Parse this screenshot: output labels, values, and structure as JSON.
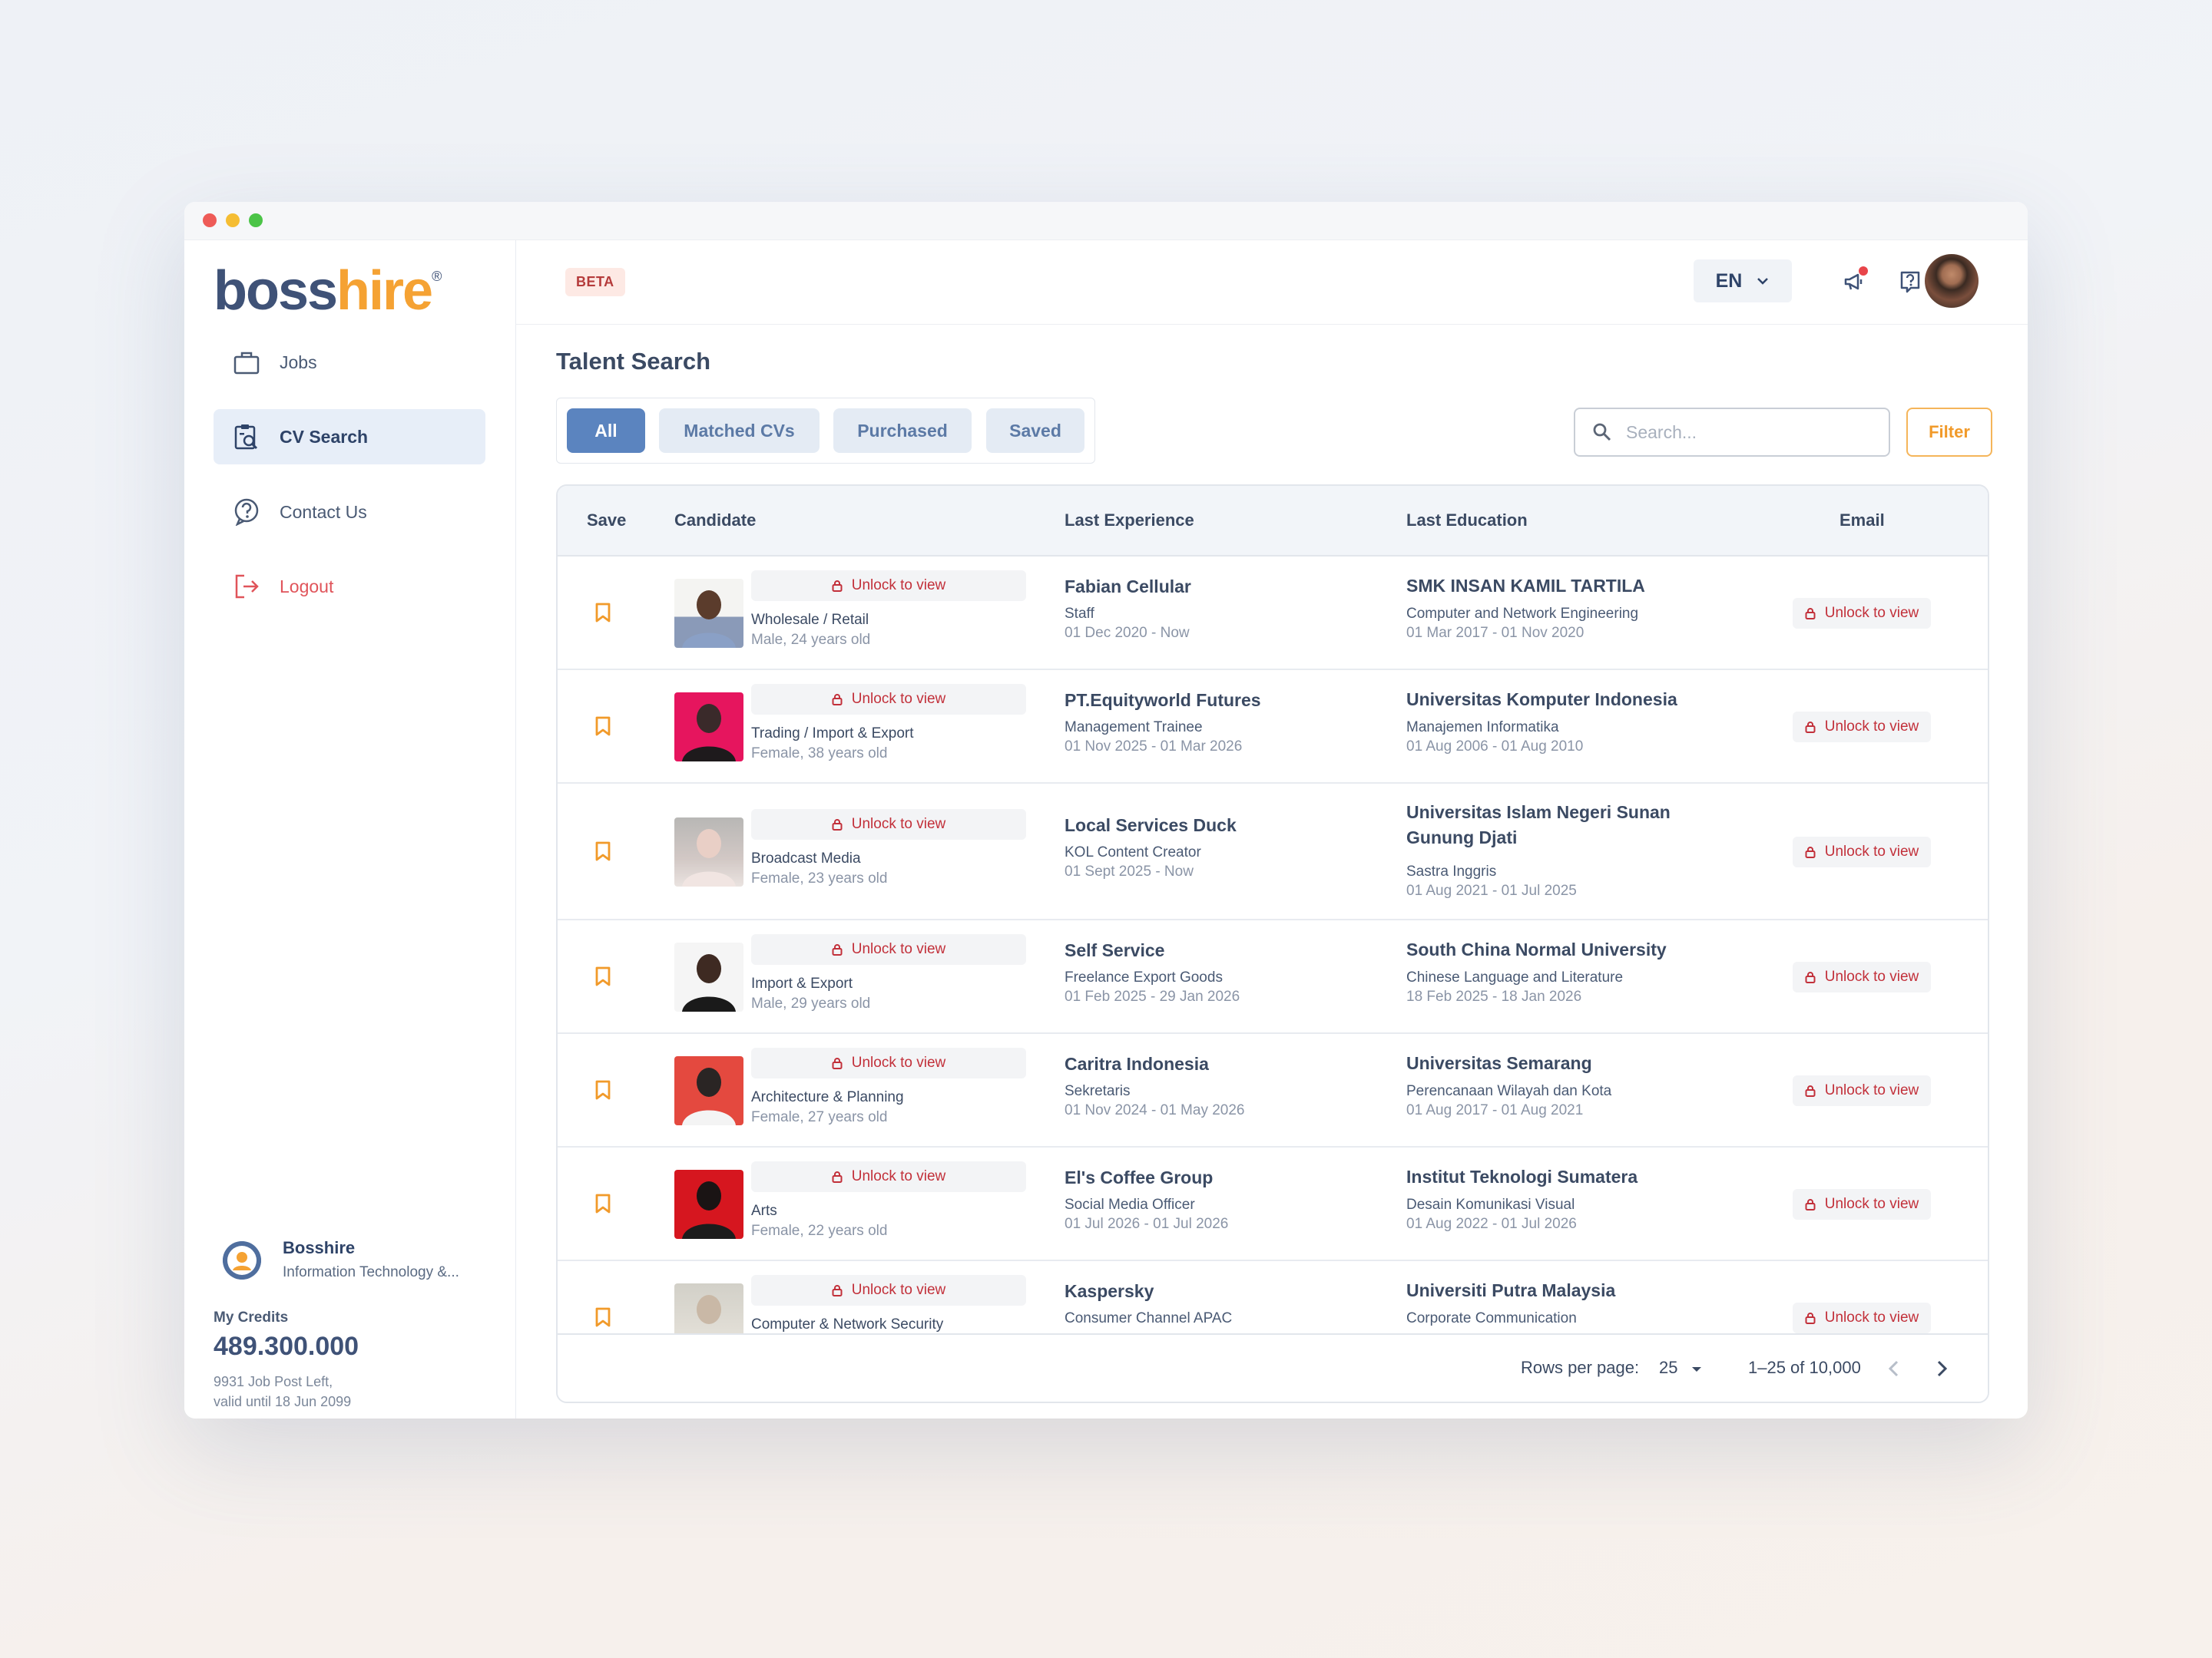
{
  "brand": {
    "part1": "boss",
    "part2": "hire",
    "reg": "®"
  },
  "sidebar": {
    "items": [
      {
        "label": "Jobs",
        "icon": "briefcase-icon"
      },
      {
        "label": "CV Search",
        "icon": "cv-search-icon",
        "active": true
      },
      {
        "label": "Contact Us",
        "icon": "help-circle-icon"
      },
      {
        "label": "Logout",
        "icon": "logout-icon"
      }
    ]
  },
  "profile": {
    "name": "Bosshire",
    "company": "Information Technology &..."
  },
  "credits": {
    "label": "My Credits",
    "value": "489.300.000",
    "note1": "9931 Job Post Left,",
    "note2": "valid until 18 Jun 2099"
  },
  "topbar": {
    "badge": "BETA",
    "language": "EN"
  },
  "page": {
    "title": "Talent Search"
  },
  "tabs": [
    "All",
    "Matched CVs",
    "Purchased",
    "Saved"
  ],
  "search": {
    "placeholder": "Search..."
  },
  "filter_label": "Filter",
  "table": {
    "headers": {
      "save": "Save",
      "candidate": "Candidate",
      "experience": "Last Experience",
      "education": "Last Education",
      "email": "Email"
    },
    "unlock_label": "Unlock to view",
    "rows": [
      {
        "industry": "Wholesale / Retail",
        "demo": "Male, 24 years old",
        "exp_company": "Fabian Cellular",
        "exp_role": "Staff",
        "exp_dates": "01 Dec 2020 - Now",
        "edu_school": "SMK INSAN KAMIL TARTILA",
        "edu_major": "Computer and Network Engineering",
        "edu_dates": "01 Mar 2017 - 01 Nov 2020"
      },
      {
        "industry": "Trading / Import & Export",
        "demo": "Female, 38 years old",
        "exp_company": "PT.Equityworld Futures",
        "exp_role": "Management Trainee",
        "exp_dates": "01 Nov 2025 - 01 Mar 2026",
        "edu_school": "Universitas Komputer Indonesia",
        "edu_major": "Manajemen Informatika",
        "edu_dates": "01 Aug 2006 - 01 Aug 2010"
      },
      {
        "industry": "Broadcast Media",
        "demo": "Female, 23 years old",
        "exp_company": "Local Services Duck",
        "exp_role": "KOL Content Creator",
        "exp_dates": "01 Sept 2025 - Now",
        "edu_school": "Universitas Islam Negeri Sunan Gunung Djati",
        "edu_major": "Sastra Inggris",
        "edu_dates": "01 Aug 2021 - 01 Jul 2025"
      },
      {
        "industry": "Import & Export",
        "demo": "Male, 29 years old",
        "exp_company": "Self Service",
        "exp_role": "Freelance Export Goods",
        "exp_dates": "01 Feb 2025 - 29 Jan 2026",
        "edu_school": "South China Normal University",
        "edu_major": "Chinese Language and Literature",
        "edu_dates": "18 Feb 2025 - 18 Jan 2026"
      },
      {
        "industry": "Architecture & Planning",
        "demo": "Female, 27 years old",
        "exp_company": "Caritra Indonesia",
        "exp_role": "Sekretaris",
        "exp_dates": "01 Nov 2024 - 01 May 2026",
        "edu_school": "Universitas Semarang",
        "edu_major": "Perencanaan Wilayah dan Kota",
        "edu_dates": "01 Aug 2017 - 01 Aug 2021"
      },
      {
        "industry": "Arts",
        "demo": "Female, 22 years old",
        "exp_company": "El's Coffee Group",
        "exp_role": "Social Media Officer",
        "exp_dates": "01 Jul 2026 - 01 Jul 2026",
        "edu_school": "Institut Teknologi Sumatera",
        "edu_major": "Desain Komunikasi Visual",
        "edu_dates": "01 Aug 2022 - 01 Jul 2026"
      },
      {
        "industry": "Computer & Network Security",
        "demo": "",
        "exp_company": "Kaspersky",
        "exp_role": "Consumer Channel APAC",
        "exp_dates": "",
        "edu_school": "Universiti Putra Malaysia",
        "edu_major": "Corporate Communication",
        "edu_dates": ""
      }
    ]
  },
  "pagination": {
    "rows_label": "Rows per page:",
    "rows_value": "25",
    "range": "1–25 of 10,000"
  },
  "colors": {
    "accent": "#5b84bf",
    "brand_orange": "#f5a233",
    "brand_navy": "#3f5277",
    "lock_red": "#c2303a"
  }
}
